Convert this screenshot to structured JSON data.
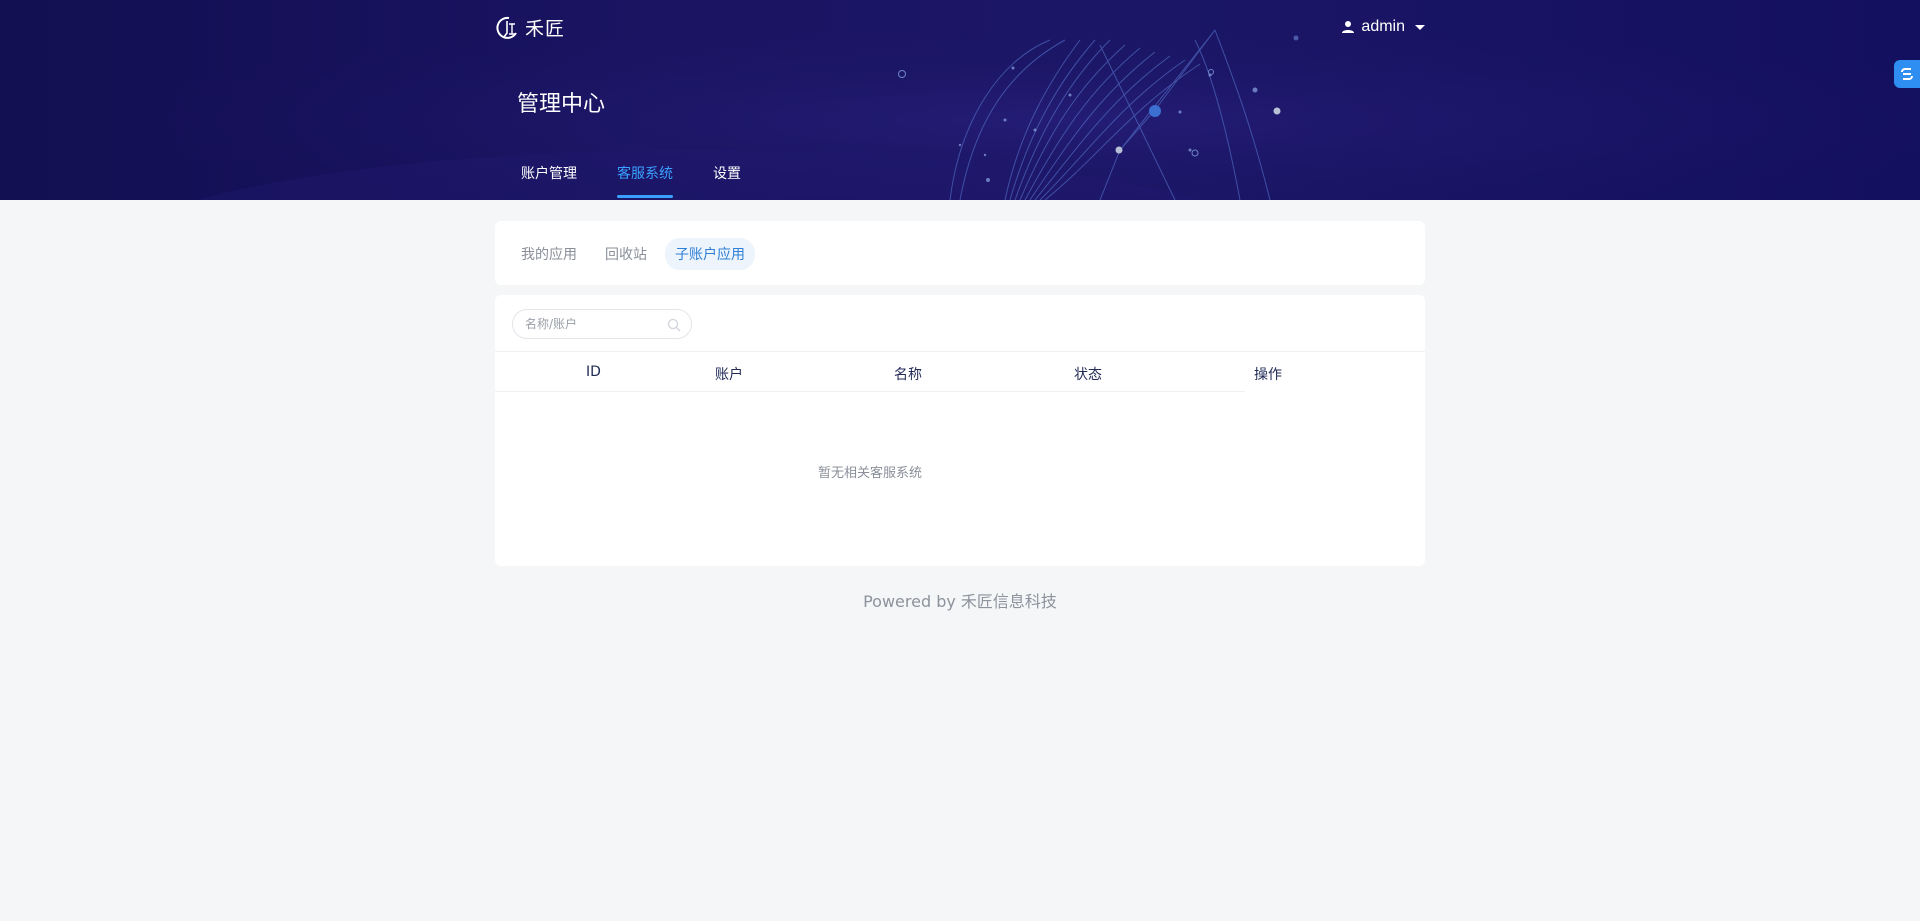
{
  "header": {
    "brand": "禾匠",
    "user": "admin",
    "page_title": "管理中心",
    "nav": [
      {
        "label": "账户管理",
        "active": false
      },
      {
        "label": "客服系统",
        "active": true
      },
      {
        "label": "设置",
        "active": false
      }
    ]
  },
  "subtabs": [
    {
      "label": "我的应用",
      "active": false
    },
    {
      "label": "回收站",
      "active": false
    },
    {
      "label": "子账户应用",
      "active": true
    }
  ],
  "search": {
    "placeholder": "名称/账户"
  },
  "table": {
    "columns": [
      "ID",
      "账户",
      "名称",
      "状态",
      "操作"
    ],
    "empty_text": "暂无相关客服系统"
  },
  "footer": "Powered by 禾匠信息科技",
  "colors": {
    "header_bg": "#1a1462",
    "accent": "#3aa0ff",
    "page_bg": "#f5f6f8"
  },
  "icons": {
    "logo": "brand-logo-icon",
    "user": "user-icon",
    "dropdown": "caret-down-icon",
    "search": "search-icon",
    "float": "link-icon"
  }
}
